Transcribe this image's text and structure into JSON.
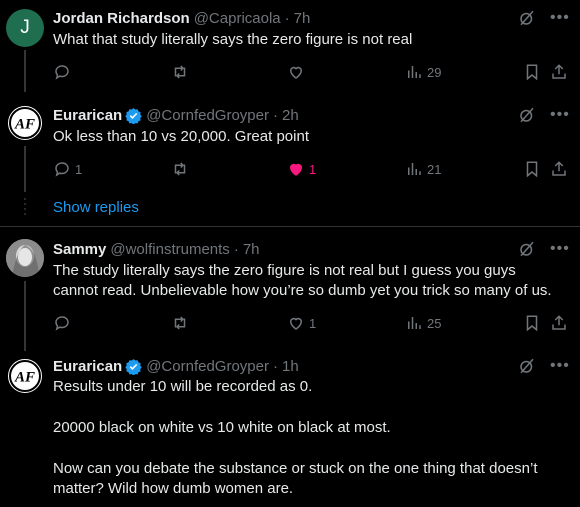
{
  "tweets": [
    {
      "name": "Jordan Richardson",
      "handle": "@Capricaola",
      "time": "7h",
      "avatar_letter": "J",
      "text": "What that study literally says the zero figure is not real",
      "replies": "",
      "retweets": "",
      "likes": "",
      "views": "29",
      "verified": false
    },
    {
      "name": "Eurarican",
      "handle": "@CornfedGroyper",
      "time": "2h",
      "avatar_logo_text": "AF",
      "text": "Ok less than 10 vs 20,000. Great point",
      "replies": "1",
      "retweets": "",
      "likes": "1",
      "views": "21",
      "verified": true,
      "liked": true
    },
    {
      "name": "Sammy",
      "handle": "@wolfinstruments",
      "time": "7h",
      "text_lines": [
        "The study literally says the zero figure is not real but I guess you guys",
        "cannot read. Unbelievable how you’re so dumb yet you trick so many of us."
      ],
      "replies": "",
      "retweets": "",
      "likes": "1",
      "views": "25",
      "verified": false
    },
    {
      "name": "Eurarican",
      "handle": "@CornfedGroyper",
      "time": "1h",
      "avatar_logo_text": "AF",
      "paragraphs": [
        "Results under 10 will be recorded as 0.",
        "20000 black on white vs 10 white on black at most.",
        "Now can you debate the substance or stuck on the one thing that doesn’t matter? Wild how dumb women are."
      ],
      "verified": true
    }
  ],
  "show_replies": "Show replies",
  "separator": "·",
  "icons": {
    "reply": "reply-icon",
    "retweet": "retweet-icon",
    "like": "heart-icon",
    "views": "views-icon",
    "bookmark": "bookmark-icon",
    "share": "share-icon",
    "grok": "grok-icon",
    "more": "more-icon",
    "verified": "verified-badge-icon"
  },
  "colors": {
    "background": "#000000",
    "text": "#e7e9ea",
    "muted": "#71767b",
    "link": "#1d9bf0",
    "like": "#f91880",
    "verified": "#1d9bf0",
    "avatar_j": "#1f6e4f"
  }
}
